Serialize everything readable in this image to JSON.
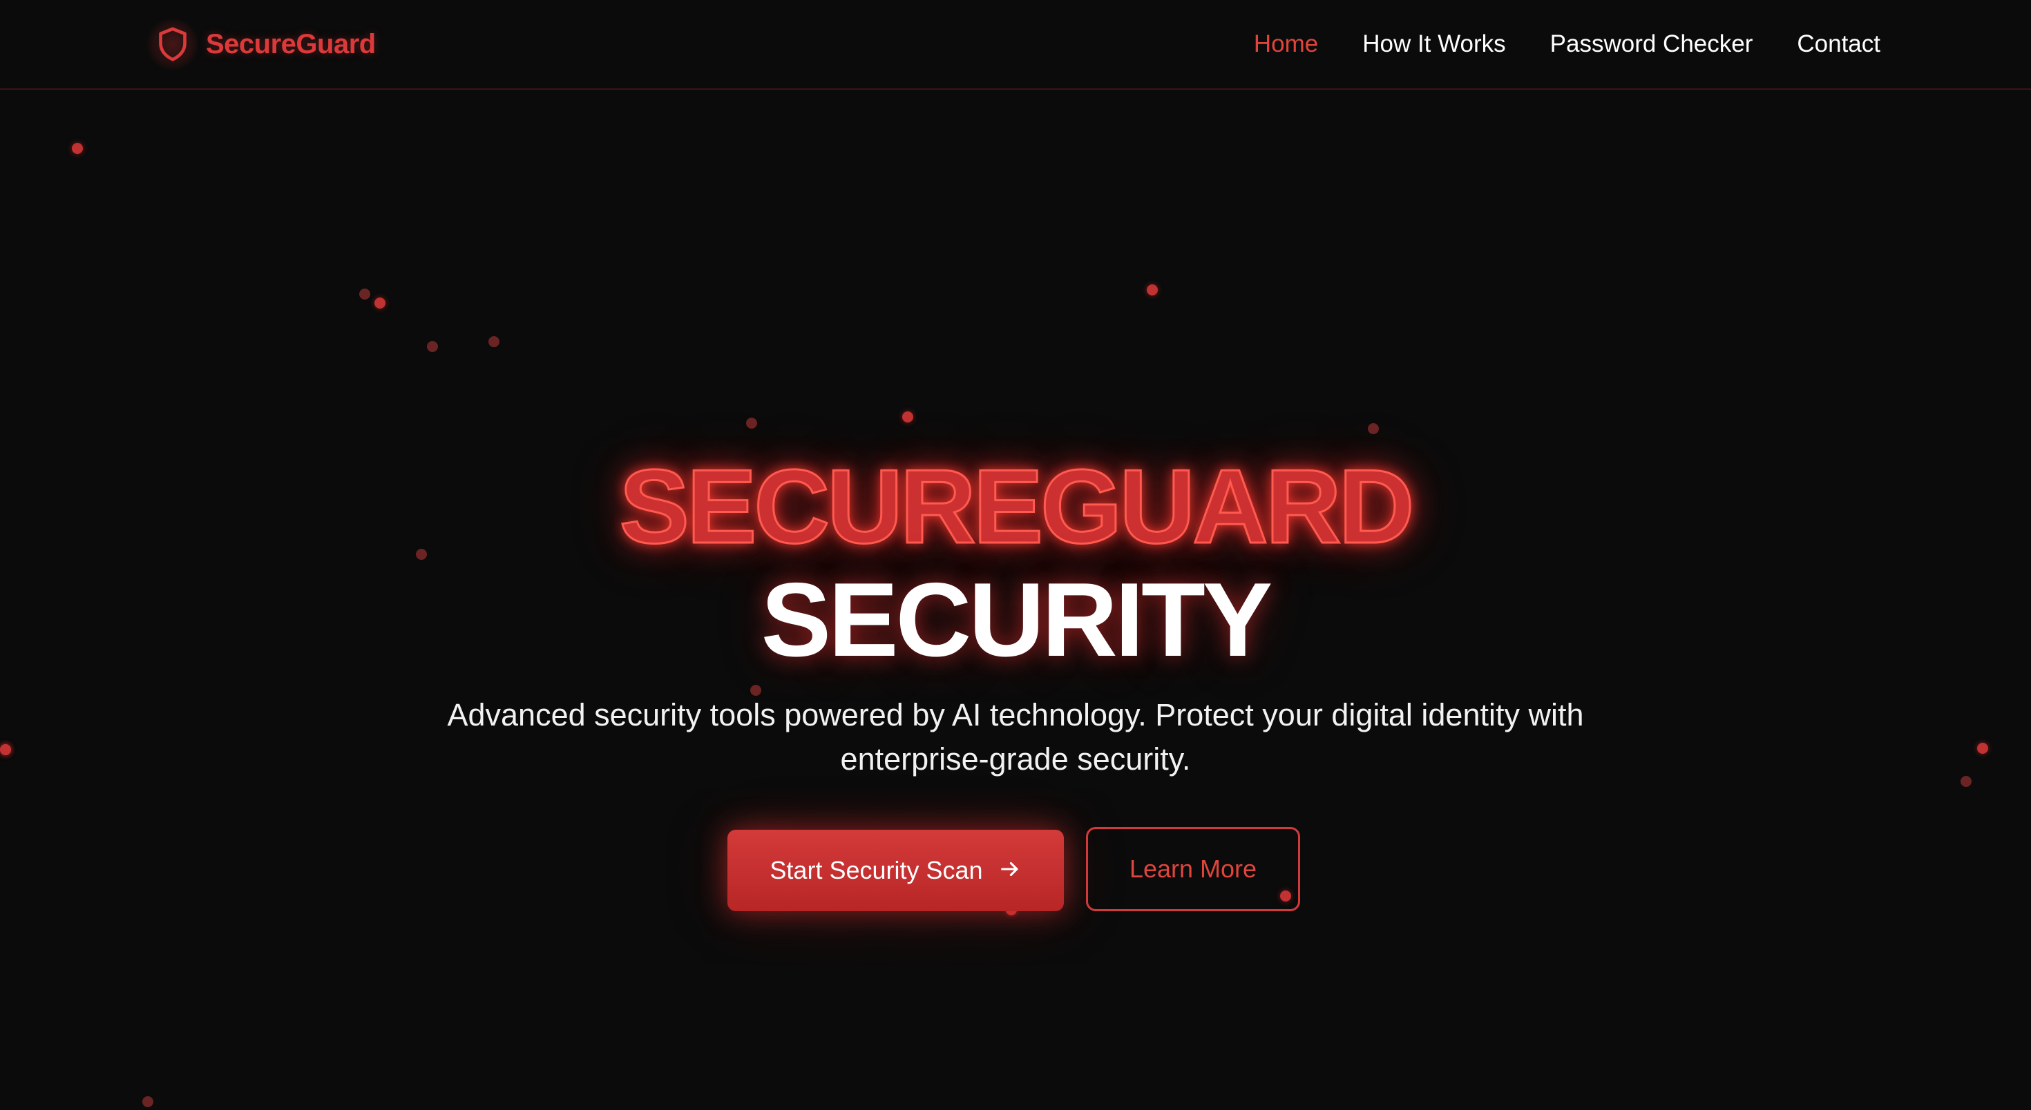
{
  "brand": {
    "name": "SecureGuard",
    "icon": "shield-icon"
  },
  "nav": {
    "items": [
      {
        "label": "Home",
        "active": true
      },
      {
        "label": "How It Works",
        "active": false
      },
      {
        "label": "Password Checker",
        "active": false
      },
      {
        "label": "Contact",
        "active": false
      }
    ]
  },
  "hero": {
    "title_line1": "SECUREGUARD",
    "title_line2": "SECURITY",
    "subtitle": "Advanced security tools powered by AI technology. Protect your digital identity with enterprise-grade security.",
    "primary_button": {
      "label": "Start Security Scan",
      "icon": "arrow-right-icon"
    },
    "secondary_button": {
      "label": "Learn More"
    }
  },
  "colors": {
    "background": "#0b0b0b",
    "accent": "#dc3a3a",
    "text": "#ffffff"
  }
}
